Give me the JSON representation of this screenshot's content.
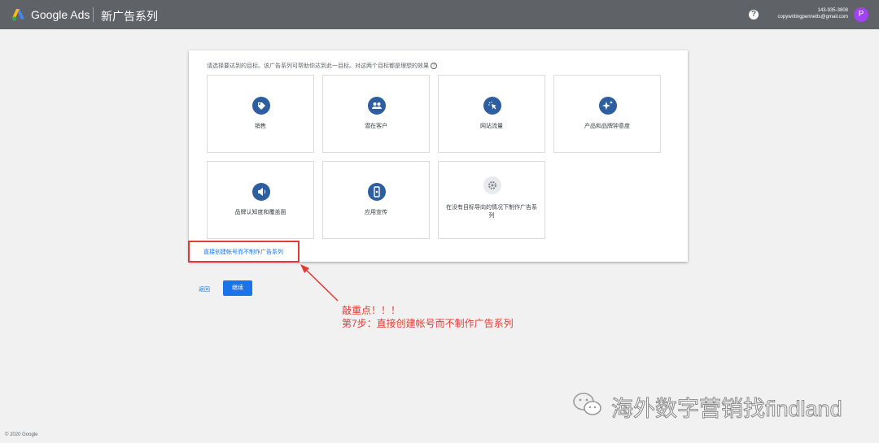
{
  "header": {
    "brand": "Google Ads",
    "title": "新广告系列",
    "account_id": "143-935-3808",
    "account_email": "copywritingpennetts@gmail.com",
    "avatar_letter": "P",
    "help_icon": "?"
  },
  "goal_panel": {
    "prompt": "请选择要达到的目标。该广告系列可帮助你达到此一目标。对这两个目标都是理想的效果",
    "cards": [
      {
        "label": "销售",
        "icon": "tag-icon"
      },
      {
        "label": "潜在客户",
        "icon": "people-icon"
      },
      {
        "label": "网站流量",
        "icon": "cursor-click-icon"
      },
      {
        "label": "产品和品牌钟意度",
        "icon": "sparkle-icon"
      },
      {
        "label": "品牌认知度和覆盖面",
        "icon": "speaker-icon"
      },
      {
        "label": "应用宣传",
        "icon": "phone-icon"
      },
      {
        "label": "在没有目标导向的情况下制作广告系列",
        "icon": "gear-icon"
      }
    ],
    "create_account_link": "直接创建帐号而不制作广告系列"
  },
  "actions": {
    "back": "返回",
    "continue": "继续"
  },
  "annotation": {
    "line1": "敲重点！！！",
    "line2": "第7步：直接创建帐号而不制作广告系列",
    "color": "#e53935"
  },
  "watermark": {
    "text": "海外数字营销找findland"
  },
  "footer": {
    "copyright": "© 2020 Google"
  }
}
